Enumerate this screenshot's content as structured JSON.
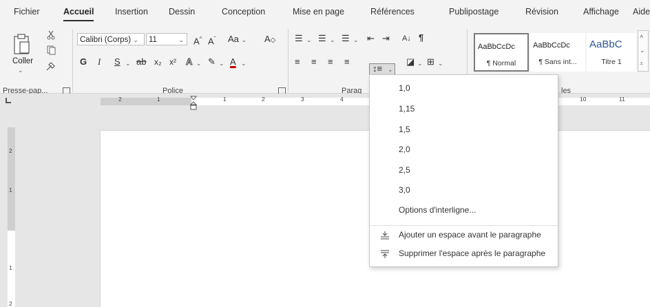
{
  "tabs": [
    "Fichier",
    "Accueil",
    "Insertion",
    "Dessin",
    "Conception",
    "Mise en page",
    "Références",
    "Publipostage",
    "Révision",
    "Affichage",
    "Aide"
  ],
  "clipboard": {
    "paste_label": "Coller",
    "group_label": "Presse-pap..."
  },
  "font": {
    "name": "Calibri (Corps)",
    "size": "11",
    "case_label": "Aa",
    "bold": "G",
    "italic": "I",
    "underline": "S",
    "strike": "ab",
    "sub": "x₂",
    "sup": "x²",
    "group_label": "Police"
  },
  "paragraph": {
    "group_label": "Parag"
  },
  "styles": {
    "items": [
      {
        "preview": "AaBbCcDc",
        "name": "¶ Normal"
      },
      {
        "preview": "AaBbCcDc",
        "name": "¶ Sans int..."
      },
      {
        "preview": "AaBbC",
        "name": "Titre 1"
      }
    ],
    "group_label": "les"
  },
  "ruler": {
    "h_left": [
      "2",
      "1"
    ],
    "h_right": [
      "1",
      "2",
      "3",
      "4"
    ],
    "h_far": [
      "10",
      "11"
    ],
    "v": [
      "2",
      "1",
      "1",
      "2"
    ]
  },
  "menu": {
    "spacings": [
      "1,0",
      "1,15",
      "1,5",
      "2,0",
      "2,5",
      "3,0"
    ],
    "options": "Options d'interligne...",
    "add_before": "Ajouter un espace avant le paragraphe",
    "remove_after": "Supprimer l'espace après le paragraphe"
  }
}
